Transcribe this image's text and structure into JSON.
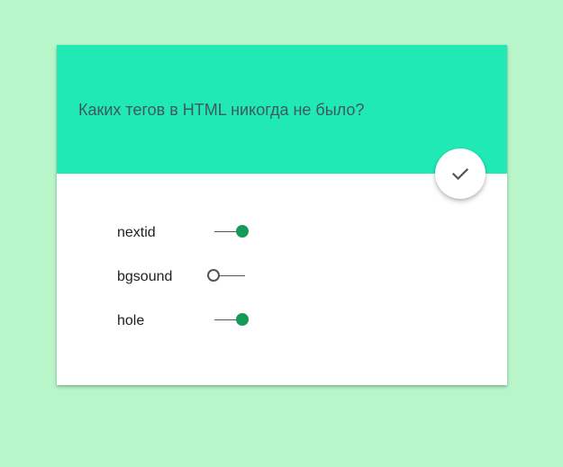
{
  "quiz": {
    "question": "Каких тегов в HTML никогда не было?",
    "submit_icon": "check-icon",
    "colors": {
      "page_background": "#b8f5c9",
      "header_background": "#20e9b6",
      "toggle_on": "#159a5a"
    },
    "options": [
      {
        "label": "nextid",
        "checked": true
      },
      {
        "label": "bgsound",
        "checked": false
      },
      {
        "label": "hole",
        "checked": true
      }
    ]
  }
}
